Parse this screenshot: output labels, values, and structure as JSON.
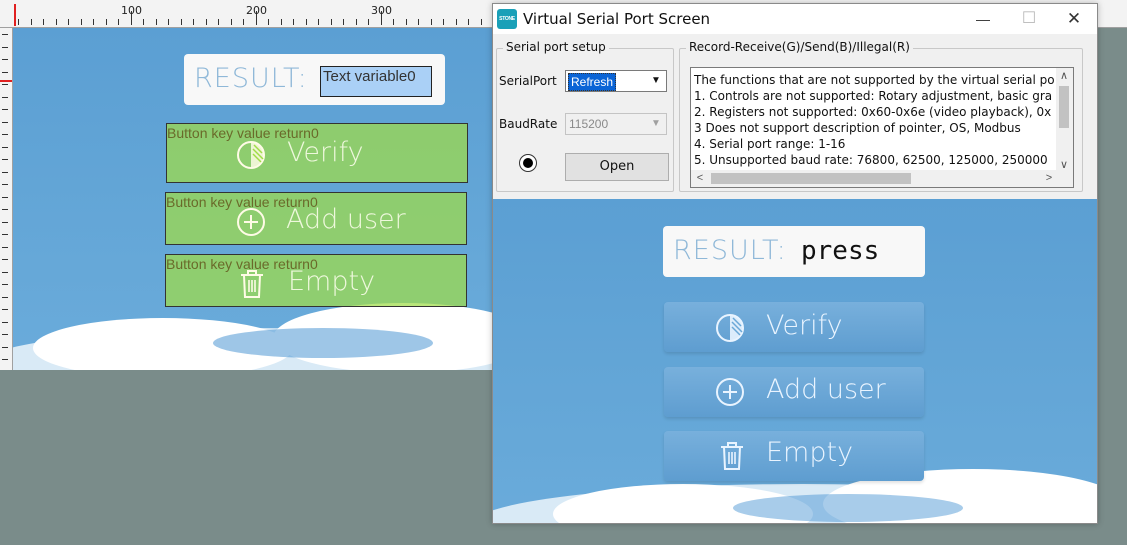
{
  "designer": {
    "ruler_numbers": [
      "100",
      "200",
      "300"
    ],
    "result_label": "RESULT:",
    "text_variable": "Text variable0",
    "overlay_caption": "Button key value return0",
    "buttons": [
      {
        "label": "Verify",
        "icon": "half-shield-icon"
      },
      {
        "label": "Add user",
        "icon": "plus-circle-icon"
      },
      {
        "label": "Empty",
        "icon": "trash-icon"
      }
    ]
  },
  "window": {
    "app_icon_text": "STONE",
    "title": "Virtual Serial Port Screen",
    "controls": {
      "minimize": "—",
      "maximize": "☐",
      "close": "✕"
    },
    "serial_setup": {
      "title": "Serial port setup",
      "port_label": "SerialPort",
      "port_value": "Refresh",
      "baud_label": "BaudRate",
      "baud_value": "115200",
      "open_label": "Open"
    },
    "record": {
      "title": "Record-Receive(G)/Send(B)/Illegal(R)",
      "lines": [
        "The functions that are not supported by the virtual serial po",
        "1. Controls are not supported: Rotary adjustment, basic gra",
        "2. Registers not supported: 0x60-0x6e (video playback), 0x",
        "3 Does not support description of pointer, OS, Modbus",
        "4. Serial port range: 1-16",
        "5. Unsupported baud rate: 76800, 62500, 125000, 250000"
      ]
    },
    "screen": {
      "result_label": "RESULT:",
      "result_value": "press",
      "buttons": [
        {
          "label": "Verify",
          "icon": "half-shield-icon"
        },
        {
          "label": "Add user",
          "icon": "plus-circle-icon"
        },
        {
          "label": "Empty",
          "icon": "trash-icon"
        }
      ]
    }
  },
  "colors": {
    "sky": "#5b9fd3",
    "button": "#6aa8d8",
    "overlay": "#a0dc46",
    "selection": "#0a64d6"
  }
}
